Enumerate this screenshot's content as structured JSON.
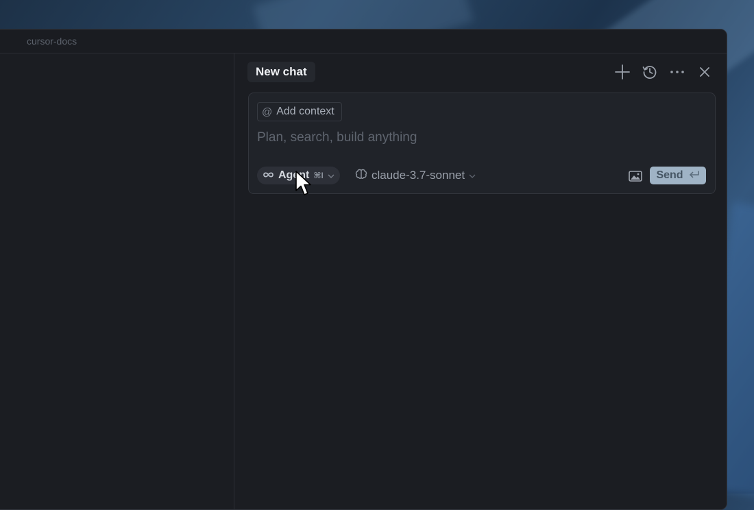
{
  "window": {
    "title": "cursor-docs"
  },
  "chat": {
    "tab_label": "New chat",
    "header_icons": [
      "plus-icon",
      "history-icon",
      "more-icon",
      "close-icon"
    ],
    "composer": {
      "add_context_label": "Add context",
      "placeholder": "Plan, search, build anything",
      "mode_label": "Agent",
      "mode_shortcut": "⌘I",
      "model_label": "claude-3.7-sonnet",
      "send_label": "Send"
    }
  },
  "colors": {
    "window_bg": "#1b1d22",
    "composer_bg": "#202329",
    "send_button_bg": "#9fb3c5",
    "mode_pill_bg": "#2d3038"
  }
}
